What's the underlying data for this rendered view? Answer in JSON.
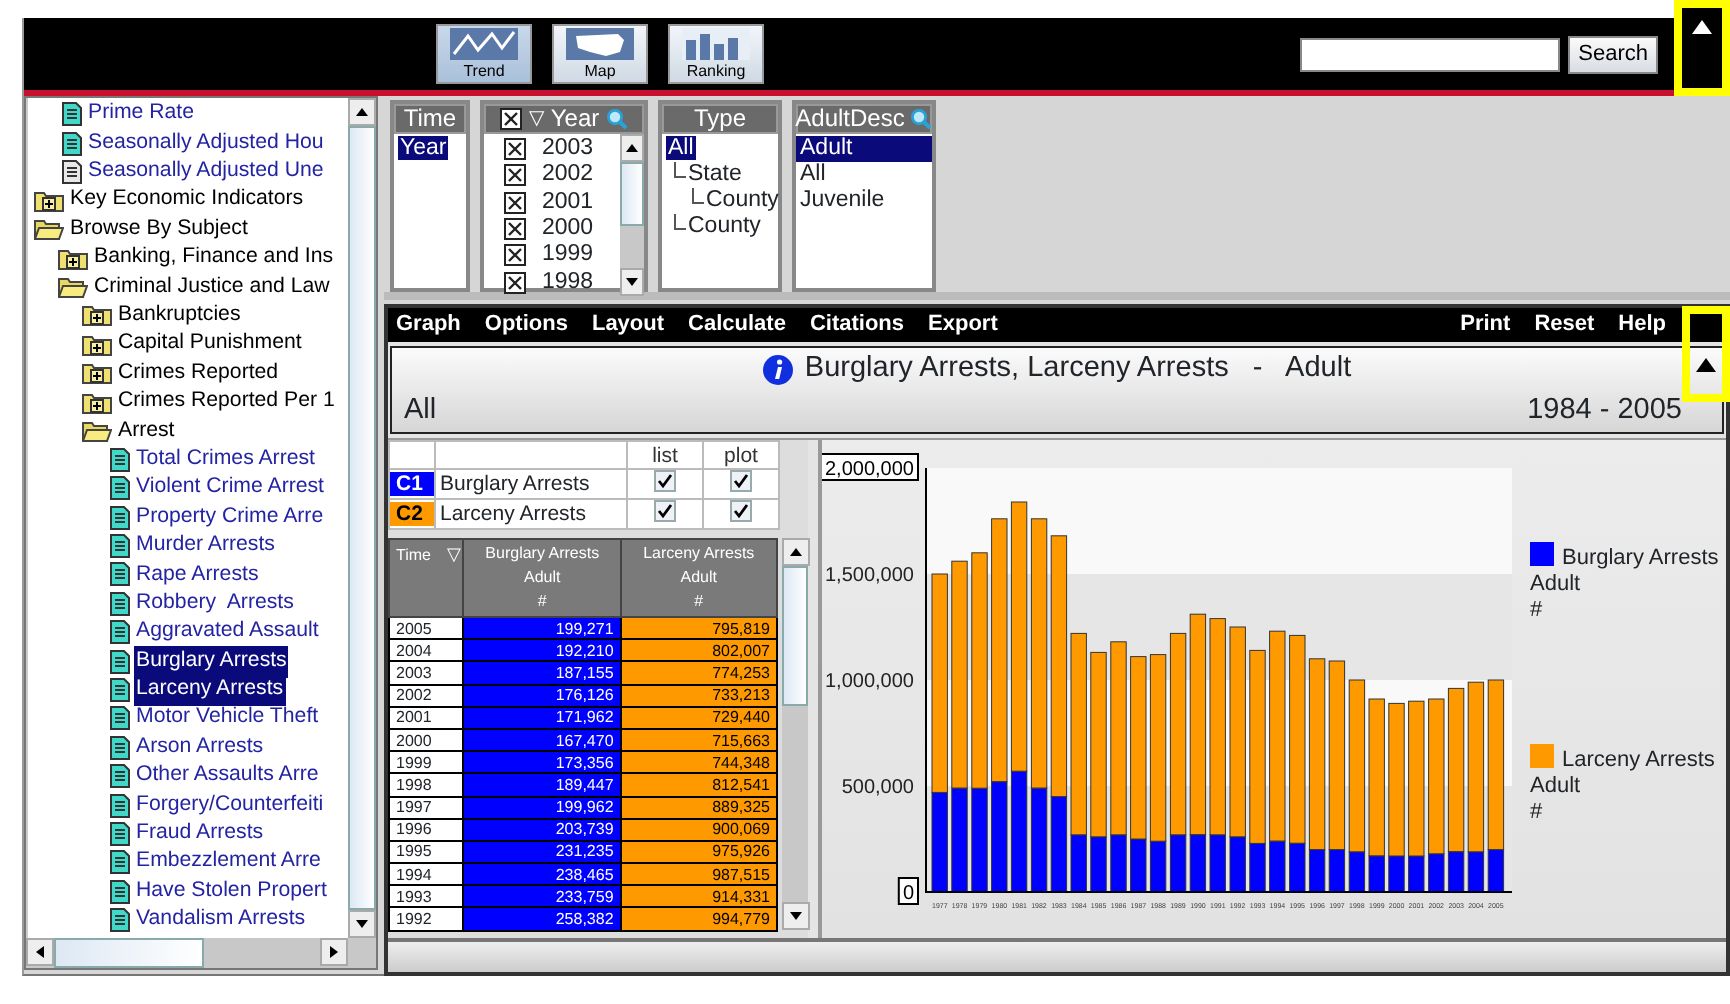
{
  "toolbar": {
    "buttons": [
      {
        "label": "Trend",
        "kind": "trend",
        "selected": true
      },
      {
        "label": "Map",
        "kind": "map",
        "selected": false
      },
      {
        "label": "Ranking",
        "kind": "ranking",
        "selected": false
      }
    ],
    "search_button": "Search"
  },
  "corner_buttons": [
    {
      "highlighted": true
    },
    {
      "highlighted": true
    }
  ],
  "tree": [
    {
      "children": [
        {
          "label": "Prime Rate",
          "kind": "document",
          "selected": false
        },
        {
          "label": "Seasonally Adjusted Hou",
          "kind": "document",
          "selected": false
        },
        {
          "label": "Seasonally Adjusted Une",
          "kind": "blank",
          "selected": false
        }
      ]
    },
    {
      "label": "Key Economic Indicators",
      "kind": "folder",
      "expanded": false,
      "selected": false
    },
    {
      "label": "Browse By Subject",
      "kind": "folder",
      "expanded": true,
      "selected": false,
      "children": [
        {
          "label": "Banking, Finance and Ins",
          "kind": "folder",
          "expanded": false,
          "selected": false
        },
        {
          "label": "Criminal Justice and Law",
          "kind": "folder",
          "expanded": true,
          "selected": false,
          "children": [
            {
              "label": "Bankruptcies",
              "kind": "folder",
              "expanded": false,
              "selected": false
            },
            {
              "label": "Capital Punishment",
              "kind": "folder",
              "expanded": false,
              "selected": false
            },
            {
              "label": "Crimes Reported",
              "kind": "folder",
              "expanded": false,
              "selected": false
            },
            {
              "label": "Crimes Reported Per 1",
              "kind": "folder",
              "expanded": false,
              "selected": false
            },
            {
              "label": "Arrest",
              "kind": "folder",
              "expanded": true,
              "selected": false,
              "children": [
                {
                  "label": "Total Crimes Arrest",
                  "kind": "document",
                  "selected": false
                },
                {
                  "label": "Violent Crime Arrest",
                  "kind": "document",
                  "selected": false
                },
                {
                  "label": "Property Crime Arre",
                  "kind": "document",
                  "selected": false
                },
                {
                  "label": "Murder Arrests",
                  "kind": "document",
                  "selected": false
                },
                {
                  "label": "Rape Arrests",
                  "kind": "document",
                  "selected": false
                },
                {
                  "label": "Robbery  Arrests",
                  "kind": "document",
                  "selected": false
                },
                {
                  "label": "Aggravated Assault",
                  "kind": "document",
                  "selected": false
                },
                {
                  "label": "Burglary Arrests",
                  "kind": "document",
                  "selected": true
                },
                {
                  "label": "Larceny Arrests",
                  "kind": "document",
                  "selected": true
                },
                {
                  "label": "Motor Vehicle Theft",
                  "kind": "document",
                  "selected": false
                },
                {
                  "label": "Arson Arrests",
                  "kind": "document",
                  "selected": false
                },
                {
                  "label": "Other Assaults Arre",
                  "kind": "document",
                  "selected": false
                },
                {
                  "label": "Forgery/Counterfeiti",
                  "kind": "document",
                  "selected": false
                },
                {
                  "label": "Fraud Arrests",
                  "kind": "document",
                  "selected": false
                },
                {
                  "label": "Embezzlement Arre",
                  "kind": "document",
                  "selected": false
                },
                {
                  "label": "Have Stolen Propert",
                  "kind": "document",
                  "selected": false
                },
                {
                  "label": "Vandalism Arrests",
                  "kind": "document",
                  "selected": false
                }
              ]
            }
          ]
        }
      ]
    }
  ],
  "filters": [
    {
      "title": "Time",
      "kind": "list",
      "items": [
        {
          "label": "Year",
          "selected": true
        }
      ]
    },
    {
      "title": "Year",
      "kind": "checklist",
      "sort_icon": "▽",
      "searchable": true,
      "all_checked": true,
      "items": [
        {
          "label": "2003",
          "checked": true
        },
        {
          "label": "2002",
          "checked": true
        },
        {
          "label": "2001",
          "checked": true
        },
        {
          "label": "2000",
          "checked": true
        },
        {
          "label": "1999",
          "checked": true
        },
        {
          "label": "1998",
          "checked": true
        }
      ]
    },
    {
      "title": "Type",
      "kind": "tree",
      "items": [
        {
          "label": "All",
          "selected": true,
          "children": [
            {
              "label": "State",
              "selected": false,
              "children": [
                {
                  "label": "County",
                  "selected": false
                }
              ]
            },
            {
              "label": "County",
              "selected": false
            }
          ]
        }
      ]
    },
    {
      "title": "AdultDesc",
      "kind": "list",
      "searchable": true,
      "items": [
        {
          "label": "Adult",
          "selected": true
        },
        {
          "label": "All",
          "selected": false
        },
        {
          "label": "Juvenile",
          "selected": false
        }
      ]
    }
  ],
  "menu": {
    "left": [
      "Graph",
      "Options",
      "Layout",
      "Calculate",
      "Citations",
      "Export"
    ],
    "right": [
      "Print",
      "Reset",
      "Help"
    ]
  },
  "title_box": {
    "title": "Burglary Arrests, Larceny Arrests   -   Adult",
    "left": "All",
    "right": "1984 - 2005"
  },
  "series_table": {
    "columns": [
      "list",
      "plot"
    ],
    "rows": [
      {
        "code": "C1",
        "name": "Burglary Arrests",
        "list_checked": true,
        "plot_checked": true
      },
      {
        "code": "C2",
        "name": "Larceny Arrests",
        "list_checked": true,
        "plot_checked": true
      }
    ]
  },
  "data_table": {
    "columns": [
      {
        "lines": [
          "Time"
        ],
        "sort_icon": "▽"
      },
      {
        "lines": [
          "Burglary Arrests",
          "Adult",
          "#"
        ]
      },
      {
        "lines": [
          "Larceny Arrests",
          "Adult",
          "#"
        ]
      }
    ],
    "rows": [
      [
        "2005",
        "199,271",
        "795,819"
      ],
      [
        "2004",
        "192,210",
        "802,007"
      ],
      [
        "2003",
        "187,155",
        "774,253"
      ],
      [
        "2002",
        "176,126",
        "733,213"
      ],
      [
        "2001",
        "171,962",
        "729,440"
      ],
      [
        "2000",
        "167,470",
        "715,663"
      ],
      [
        "1999",
        "173,356",
        "744,348"
      ],
      [
        "1998",
        "189,447",
        "812,541"
      ],
      [
        "1997",
        "199,962",
        "889,325"
      ],
      [
        "1996",
        "203,739",
        "900,069"
      ],
      [
        "1995",
        "231,235",
        "975,926"
      ],
      [
        "1994",
        "238,465",
        "987,515"
      ],
      [
        "1993",
        "233,759",
        "914,331"
      ],
      [
        "1992",
        "258,382",
        "994,779"
      ]
    ]
  },
  "chart": {
    "chart_data": {
      "type": "bar",
      "stacked": true,
      "categories": [
        "1977",
        "1978",
        "1979",
        "1980",
        "1981",
        "1982",
        "1983",
        "1984",
        "1985",
        "1986",
        "1987",
        "1988",
        "1989",
        "1990",
        "1991",
        "1992",
        "1993",
        "1994",
        "1995",
        "1996",
        "1997",
        "1998",
        "1999",
        "2000",
        "2001",
        "2002",
        "2003",
        "2004",
        "2005"
      ],
      "series": [
        {
          "name": "Burglary Arrests",
          "color": "#0000ff",
          "values": [
            470000,
            490000,
            490000,
            520000,
            570000,
            490000,
            450000,
            270000,
            260000,
            270000,
            250000,
            240000,
            270000,
            270000,
            270000,
            260000,
            230000,
            240000,
            230000,
            200000,
            200000,
            190000,
            170000,
            170000,
            170000,
            180000,
            190000,
            190000,
            200000
          ]
        },
        {
          "name": "Larceny Arrests",
          "color": "#ff9900",
          "values": [
            1030000,
            1070000,
            1110000,
            1240000,
            1270000,
            1270000,
            1230000,
            950000,
            870000,
            910000,
            860000,
            880000,
            950000,
            1040000,
            1020000,
            990000,
            910000,
            990000,
            980000,
            900000,
            890000,
            810000,
            740000,
            720000,
            730000,
            730000,
            770000,
            800000,
            800000
          ]
        }
      ],
      "ylim": [
        0,
        2000000
      ],
      "yticks": [
        {
          "value": 0,
          "label": "0"
        },
        {
          "value": 500000,
          "label": "500,000"
        },
        {
          "value": 1000000,
          "label": "1,000,000"
        },
        {
          "value": 1500000,
          "label": "1,500,000"
        },
        {
          "value": 2000000,
          "label": "2,000,000"
        }
      ]
    },
    "legend": [
      {
        "lines": [
          "Adult",
          "#"
        ]
      },
      {
        "lines": [
          "Adult",
          "#"
        ]
      }
    ]
  }
}
